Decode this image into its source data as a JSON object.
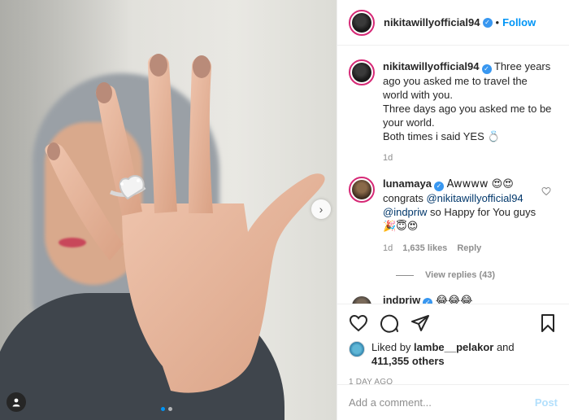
{
  "post": {
    "author": "nikitawillyofficial94",
    "header_separator": "•",
    "follow_label": "Follow",
    "caption": "Three years ago you asked me to travel the world with you.\nThree days ago you asked me to be your world.\nBoth times i said YES 💍",
    "caption_age": "1d",
    "image_alt": "Hand showing heart-shaped diamond engagement ring"
  },
  "comments": [
    {
      "username": "lunamaya",
      "text_start": "Awwww 😍😍",
      "text_congrats": "congrats ",
      "mention1": "@nikitawillyofficial94",
      "mention2": "@indpriw",
      "text_end": " so Happy for You guys",
      "emoji_line": "🎉😇😍",
      "age": "1d",
      "likes": "1,635 likes",
      "reply_label": "Reply",
      "view_replies": "View replies (43)"
    },
    {
      "username": "indpriw",
      "text": "😂😂😂"
    }
  ],
  "actions": {
    "liked_by_prefix": "Liked by ",
    "liked_by_user": "lambe__pelakor",
    "and": " and",
    "others_count": "411,355 others",
    "timestamp": "1 DAY AGO"
  },
  "composer": {
    "placeholder": "Add a comment...",
    "post_label": "Post"
  },
  "carousel": {
    "current": 1,
    "total": 2
  },
  "colors": {
    "accent": "#0095f6",
    "verified": "#3897f0",
    "ring": "#d62976"
  }
}
